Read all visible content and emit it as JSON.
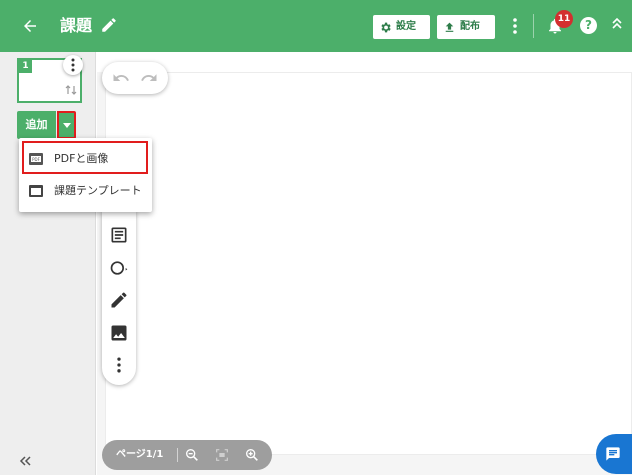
{
  "header": {
    "back_icon": "arrow-left-icon",
    "title": "課題",
    "edit_icon": "pencil-icon",
    "settings_label": "設定",
    "settings_icon": "gear-icon",
    "distribute_label": "配布",
    "distribute_icon": "upload-icon",
    "more_icon": "kebab-vertical-icon",
    "notifications_icon": "bell-icon",
    "notification_count": "11",
    "help_icon": "question-circle-icon",
    "collapse_icon": "chevron-up-double-icon",
    "bar_color": "#4caf6a"
  },
  "sidebar": {
    "thumbnail": {
      "page_number": "1",
      "menu_icon": "kebab-vertical-icon",
      "sort_icon": "sort-arrows-icon"
    },
    "add_button_label": "追加",
    "add_dropdown_icon": "caret-down-icon",
    "expand_icon": "double-chevron-left-icon"
  },
  "add_menu": {
    "items": [
      {
        "label": "PDFと画像",
        "icon": "pdf-file-icon"
      },
      {
        "label": "課題テンプレート",
        "icon": "template-icon"
      }
    ]
  },
  "toolbar": {
    "undo_icon": "undo-icon",
    "redo_icon": "redo-icon",
    "tools": [
      {
        "icon": "text-box-icon"
      },
      {
        "icon": "circle-shape-icon"
      },
      {
        "icon": "pen-icon"
      },
      {
        "icon": "image-icon"
      },
      {
        "icon": "more-vertical-icon"
      }
    ]
  },
  "pagebar": {
    "page_label": "ページ1/1",
    "zoom_out_icon": "zoom-out-icon",
    "fit_icon": "fit-screen-icon",
    "zoom_in_icon": "zoom-in-icon"
  },
  "chat": {
    "icon": "chat-bubble-icon"
  },
  "colors": {
    "accent": "#4caf6a",
    "highlight": "#e11d1d",
    "chat": "#1976d2"
  }
}
